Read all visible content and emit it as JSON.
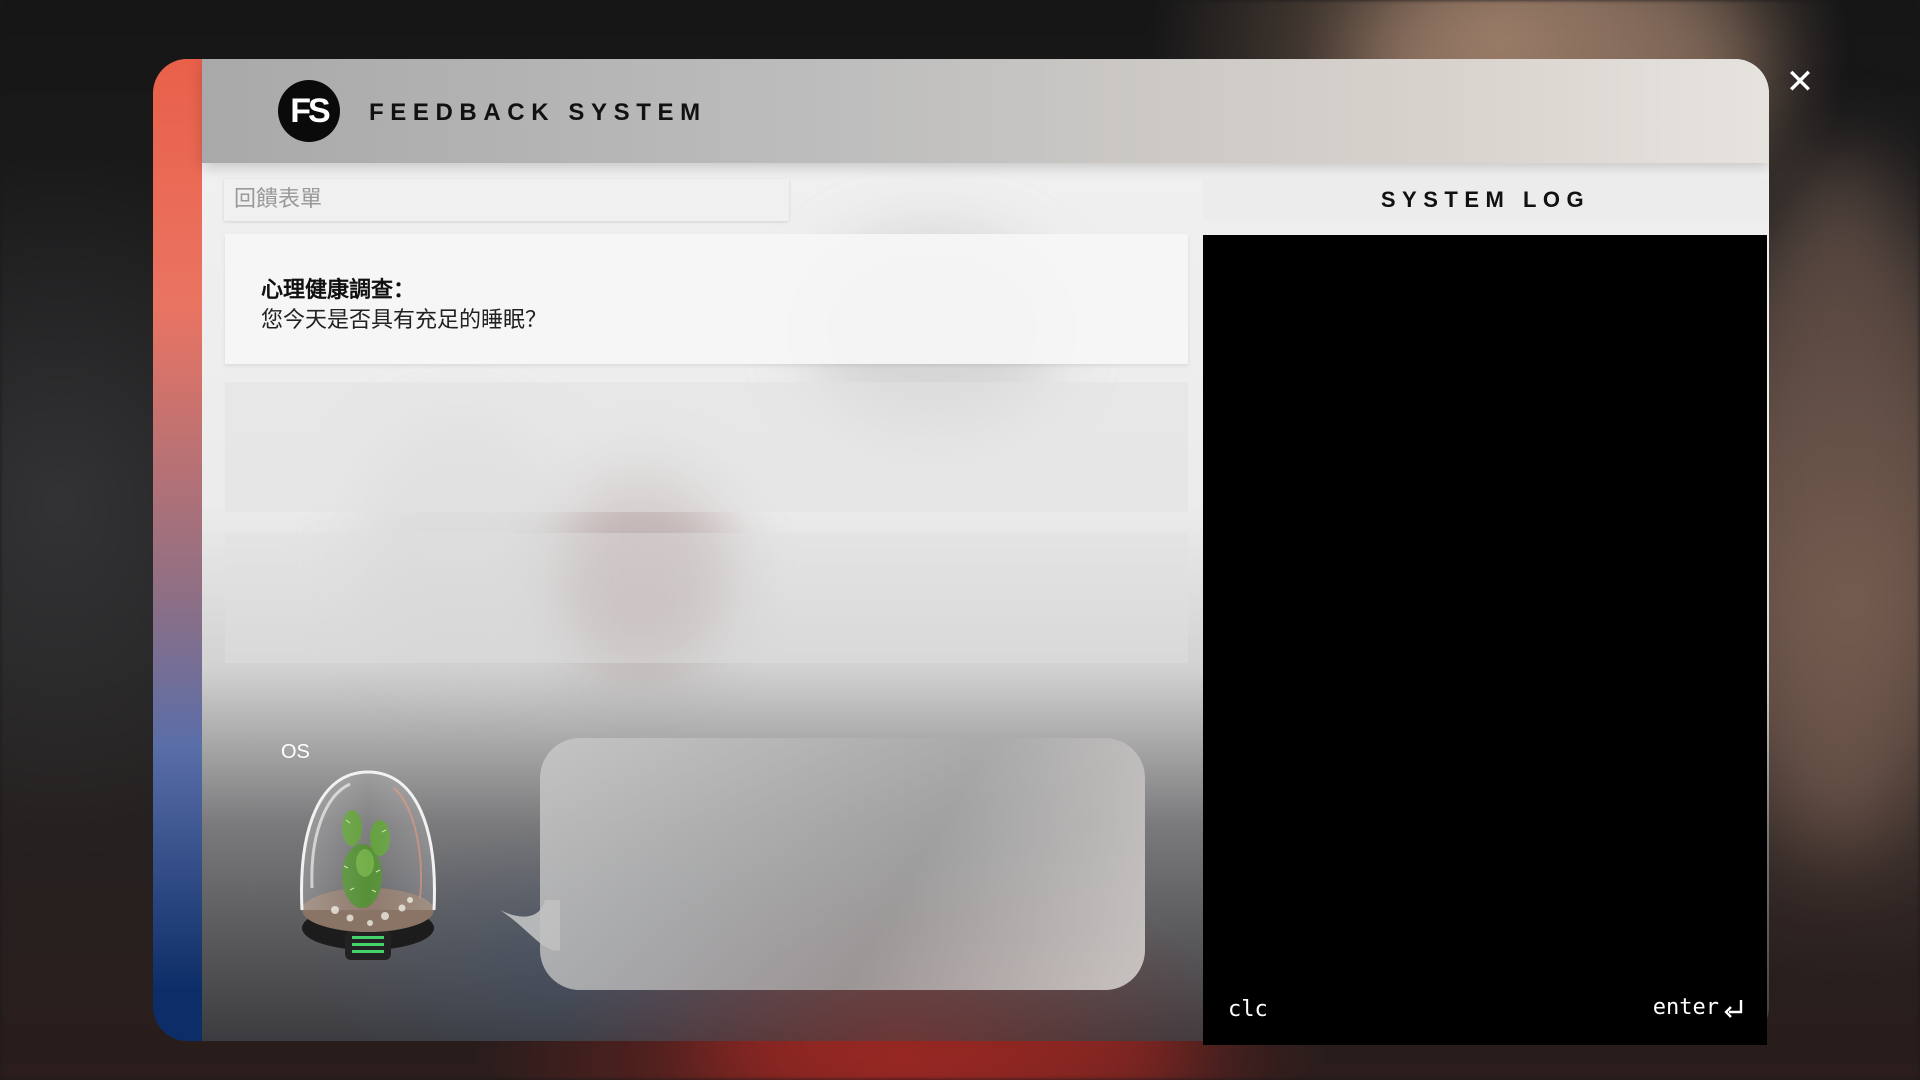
{
  "header": {
    "logo_text": "FS",
    "title": "FEEDBACK SYSTEM",
    "close_icon": "close-icon"
  },
  "form": {
    "tab_label": "回饋表單",
    "question": {
      "title": "心理健康調查：",
      "text": "您今天是否具有充足的睡眠？"
    }
  },
  "system_log": {
    "title": "SYSTEM LOG",
    "clc_label": "clc",
    "enter_label": "enter",
    "enter_icon": "return-arrow-icon"
  },
  "assistant": {
    "label": "OS",
    "avatar": "cactus-terrarium-icon",
    "message": ""
  },
  "colors": {
    "accent_top": "#e9604a",
    "accent_bottom": "#0c2d67",
    "log_bg": "#000000"
  }
}
